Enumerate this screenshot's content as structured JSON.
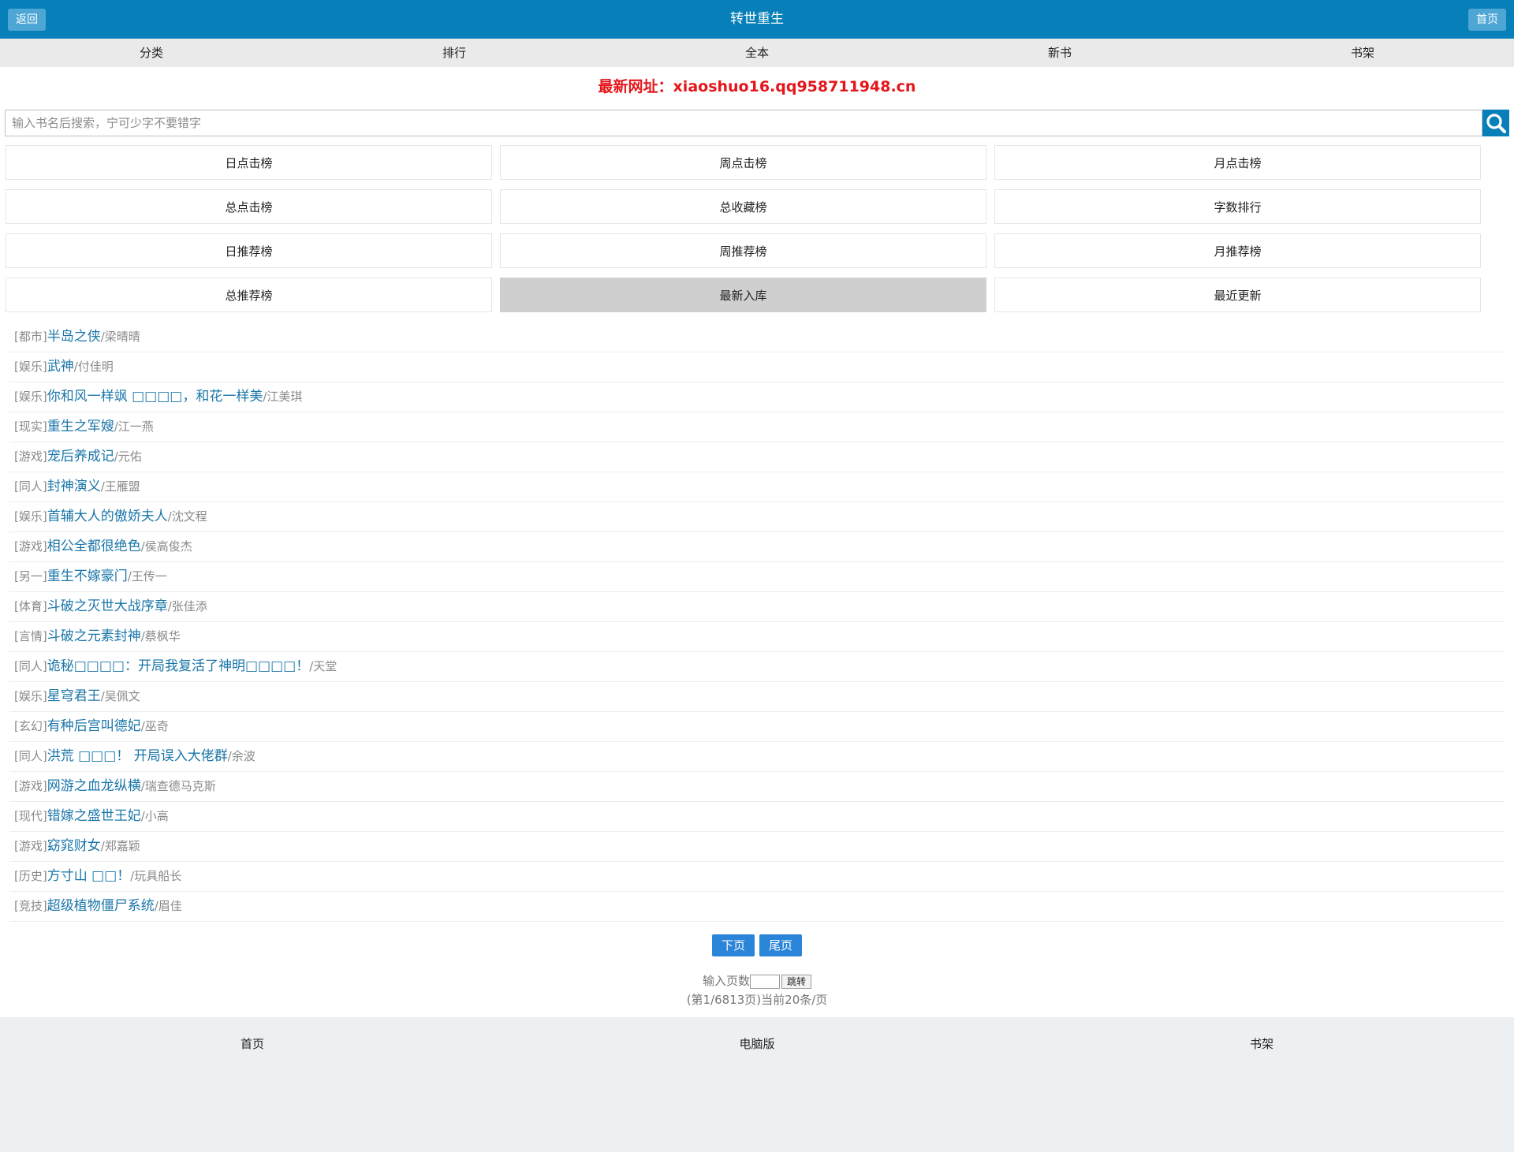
{
  "header": {
    "title": "转世重生",
    "back_label": "返回",
    "home_label": "首页",
    "bg_color": "#0780b9"
  },
  "nav": {
    "items": [
      "分类",
      "排行",
      "全本",
      "新书",
      "书架"
    ]
  },
  "notice": "最新网址：xiaoshuo16.qq958711948.cn",
  "search": {
    "placeholder": "输入书名后搜索，宁可少字不要错字",
    "value": "",
    "button_icon": "search-icon"
  },
  "ranks": {
    "items": [
      "日点击榜",
      "周点击榜",
      "月点击榜",
      "总点击榜",
      "总收藏榜",
      "字数排行",
      "日推荐榜",
      "周推荐榜",
      "月推荐榜",
      "总推荐榜",
      "最新入库",
      "最近更新"
    ],
    "active": "最新入库"
  },
  "books": [
    {
      "cat": "[都市]",
      "name": "半岛之侠",
      "author": "/梁晴晴"
    },
    {
      "cat": "[娱乐]",
      "name": "武神",
      "author": "/付佳明"
    },
    {
      "cat": "[娱乐]",
      "name": "你和风一样飒 □□□□，和花一样美",
      "author": "/江美琪"
    },
    {
      "cat": "[现实]",
      "name": "重生之军嫂",
      "author": "/江一燕"
    },
    {
      "cat": "[游戏]",
      "name": "宠后养成记",
      "author": "/元佑"
    },
    {
      "cat": "[同人]",
      "name": "封神演义",
      "author": "/王雁盟"
    },
    {
      "cat": "[娱乐]",
      "name": "首辅大人的傲娇夫人",
      "author": "/沈文程"
    },
    {
      "cat": "[游戏]",
      "name": "相公全都很绝色",
      "author": "/侯高俊杰"
    },
    {
      "cat": "[另一]",
      "name": "重生不嫁豪门",
      "author": "/王传一"
    },
    {
      "cat": "[体育]",
      "name": "斗破之灭世大战序章",
      "author": "/张佳添"
    },
    {
      "cat": "[言情]",
      "name": "斗破之元素封神",
      "author": "/蔡枫华"
    },
    {
      "cat": "[同人]",
      "name": "诡秘□□□□：开局我复活了神明□□□□！",
      "author": "/天堂"
    },
    {
      "cat": "[娱乐]",
      "name": "星穹君王",
      "author": "/吴佩文"
    },
    {
      "cat": "[玄幻]",
      "name": "有种后宫叫德妃",
      "author": "/巫奇"
    },
    {
      "cat": "[同人]",
      "name": "洪荒 □□□！ 开局误入大佬群",
      "author": "/余波"
    },
    {
      "cat": "[游戏]",
      "name": "网游之血龙纵横",
      "author": "/瑞查德马克斯"
    },
    {
      "cat": "[现代]",
      "name": "错嫁之盛世王妃",
      "author": "/小高"
    },
    {
      "cat": "[游戏]",
      "name": "窈窕财女",
      "author": "/郑嘉颖"
    },
    {
      "cat": "[历史]",
      "name": "方寸山 □□！",
      "author": "/玩具船长"
    },
    {
      "cat": "[竞技]",
      "name": "超级植物僵尸系统",
      "author": "/眉佳"
    }
  ],
  "pager": {
    "next_label": "下页",
    "last_label": "尾页",
    "jump_label": "输入页数",
    "jump_button": "跳转",
    "jump_value": "",
    "info": "(第1/6813页)当前20条/页"
  },
  "footer": {
    "links": [
      "首页",
      "电脑版",
      "书架"
    ]
  }
}
